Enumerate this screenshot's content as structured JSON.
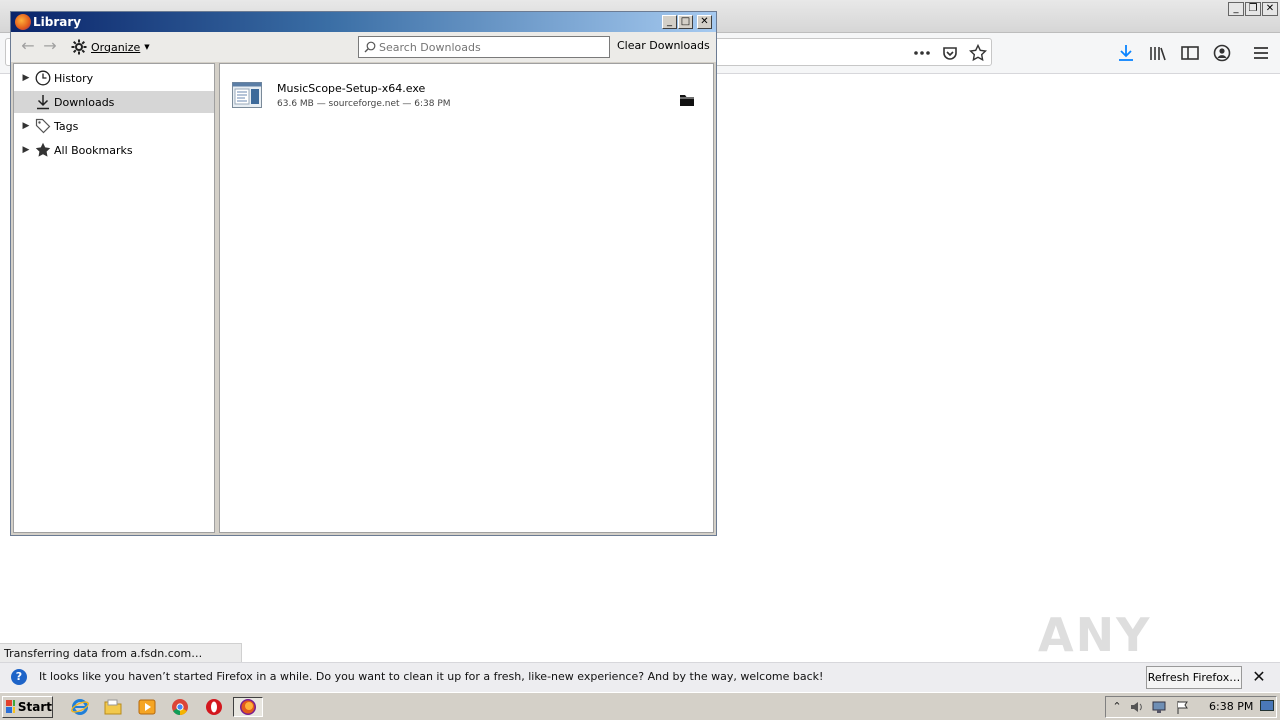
{
  "firefox": {
    "notification": {
      "message": "It looks like you haven’t started Firefox in a while. Do you want to clean it up for a fresh, like-new experience? And by the way, welcome back!",
      "button_label": "Refresh Firefox…",
      "close_label": "✕"
    },
    "status_text": "Transferring data from a.fsdn.com…",
    "toolbar_icons": [
      "page-actions-icon",
      "pocket-icon",
      "bookmark-star-icon",
      "downloads-icon",
      "library-icon",
      "sidebar-icon",
      "account-icon",
      "menu-icon"
    ]
  },
  "library": {
    "title": "Library",
    "toolbar": {
      "organize_label": "Organize",
      "search_placeholder": "Search Downloads",
      "clear_label": "Clear Downloads"
    },
    "tree": [
      {
        "label": "History",
        "icon": "clock-icon",
        "expandable": true,
        "selected": false
      },
      {
        "label": "Downloads",
        "icon": "download-arrow-icon",
        "expandable": false,
        "selected": true
      },
      {
        "label": "Tags",
        "icon": "tag-icon",
        "expandable": true,
        "selected": false
      },
      {
        "label": "All Bookmarks",
        "icon": "star-icon",
        "expandable": true,
        "selected": false
      }
    ],
    "downloads": [
      {
        "filename": "MusicScope-Setup-x64.exe",
        "meta": "63.6 MB — sourceforge.net — 6:38 PM"
      }
    ]
  },
  "taskbar": {
    "start_label": "Start",
    "apps": [
      "ie-icon",
      "explorer-icon",
      "media-player-icon",
      "chrome-icon",
      "opera-icon",
      "firefox-icon"
    ],
    "clock": "6:38 PM"
  },
  "watermark": "ANY RUN",
  "colors": {
    "dialog_title_start": "#0a246a",
    "dialog_title_end": "#a6caf0",
    "download_accent": "#0a84ff",
    "notif_info": "#1e64c8"
  }
}
